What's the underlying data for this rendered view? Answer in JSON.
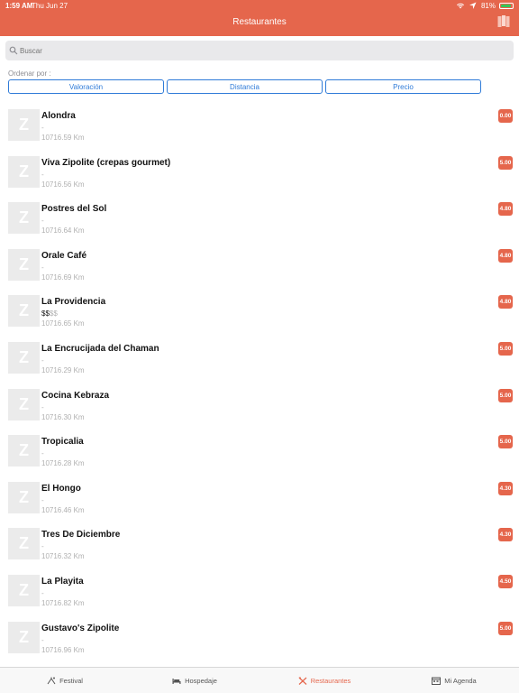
{
  "status": {
    "time": "1:59 AM",
    "date": "Thu Jun 27",
    "battery": "81%"
  },
  "nav": {
    "title": "Restaurantes"
  },
  "search": {
    "placeholder": "Buscar"
  },
  "sort": {
    "label": "Ordenar por :",
    "options": [
      "Valoración",
      "Distancia",
      "Precio"
    ]
  },
  "restaurants": [
    {
      "name": "Alondra",
      "price_on": "",
      "price_off": "-",
      "distance": "10716.59 Km",
      "rating": "0.00"
    },
    {
      "name": "Viva Zipolite (crepas gourmet)",
      "price_on": "",
      "price_off": "-",
      "distance": "10716.56 Km",
      "rating": "5.00"
    },
    {
      "name": "Postres del Sol",
      "price_on": "",
      "price_off": "-",
      "distance": "10716.64 Km",
      "rating": "4.80"
    },
    {
      "name": "Orale Café",
      "price_on": "",
      "price_off": "-",
      "distance": "10716.69 Km",
      "rating": "4.80"
    },
    {
      "name": "La Providencia",
      "price_on": "$$",
      "price_off": "$$",
      "distance": "10716.65 Km",
      "rating": "4.80"
    },
    {
      "name": "La Encrucijada del Chaman",
      "price_on": "",
      "price_off": "-",
      "distance": "10716.29 Km",
      "rating": "5.00"
    },
    {
      "name": "Cocina Kebraza",
      "price_on": "",
      "price_off": "-",
      "distance": "10716.30 Km",
      "rating": "5.00"
    },
    {
      "name": "Tropicalia",
      "price_on": "",
      "price_off": "-",
      "distance": "10716.28 Km",
      "rating": "5.00"
    },
    {
      "name": "El Hongo",
      "price_on": "",
      "price_off": "-",
      "distance": "10716.46 Km",
      "rating": "4.30"
    },
    {
      "name": "Tres De Diciembre",
      "price_on": "",
      "price_off": "-",
      "distance": "10716.32 Km",
      "rating": "4.30"
    },
    {
      "name": "La Playita",
      "price_on": "",
      "price_off": "-",
      "distance": "10716.82 Km",
      "rating": "4.50"
    },
    {
      "name": "Gustavo's Zipolite",
      "price_on": "",
      "price_off": "-",
      "distance": "10716.96 Km",
      "rating": "5.00"
    }
  ],
  "thumb_letter": "Z",
  "tabs": [
    {
      "label": "Festival",
      "icon": "festival-icon"
    },
    {
      "label": "Hospedaje",
      "icon": "bed-icon"
    },
    {
      "label": "Restaurantes",
      "icon": "fork-knife-icon"
    },
    {
      "label": "Mi Agenda",
      "icon": "agenda-icon"
    }
  ],
  "colors": {
    "accent": "#e5664c",
    "link": "#2f7bd8"
  }
}
